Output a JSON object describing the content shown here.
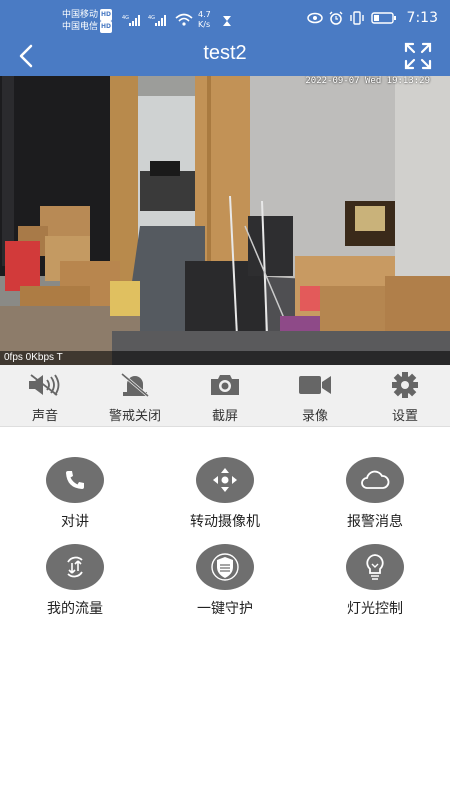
{
  "status_bar": {
    "carrier_1": "中国移动",
    "carrier_2": "中国电信",
    "hd_badge": "HD",
    "network_type": "4G",
    "speed_value": "4.7",
    "speed_unit": "K/s",
    "time": "7:13",
    "icons": [
      "eye-icon",
      "alarm-icon",
      "vibrate-icon",
      "battery-icon"
    ]
  },
  "header": {
    "title": "test2",
    "back_icon": "back-arrow-icon",
    "fullscreen_icon": "fullscreen-icon",
    "background": "#4a7bc4"
  },
  "video": {
    "osd_timestamp": "2022-09-07 Wed 19:13:29",
    "stream_info": "0fps 0Kbps T"
  },
  "toolbar": {
    "items": [
      {
        "label": "声音",
        "icon": "speaker-muted-icon"
      },
      {
        "label": "警戒关闭",
        "icon": "alarm-off-icon"
      },
      {
        "label": "截屏",
        "icon": "camera-icon"
      },
      {
        "label": "录像",
        "icon": "video-record-icon"
      },
      {
        "label": "设置",
        "icon": "gear-icon"
      }
    ]
  },
  "functions": {
    "items": [
      {
        "label": "对讲",
        "icon": "phone-icon"
      },
      {
        "label": "转动摄像机",
        "icon": "direction-pad-icon"
      },
      {
        "label": "报警消息",
        "icon": "cloud-icon"
      },
      {
        "label": "我的流量",
        "icon": "data-flow-icon"
      },
      {
        "label": "一键守护",
        "icon": "shield-icon"
      },
      {
        "label": "灯光控制",
        "icon": "light-bulb-icon"
      }
    ],
    "circle_color": "#6f6f6f"
  }
}
